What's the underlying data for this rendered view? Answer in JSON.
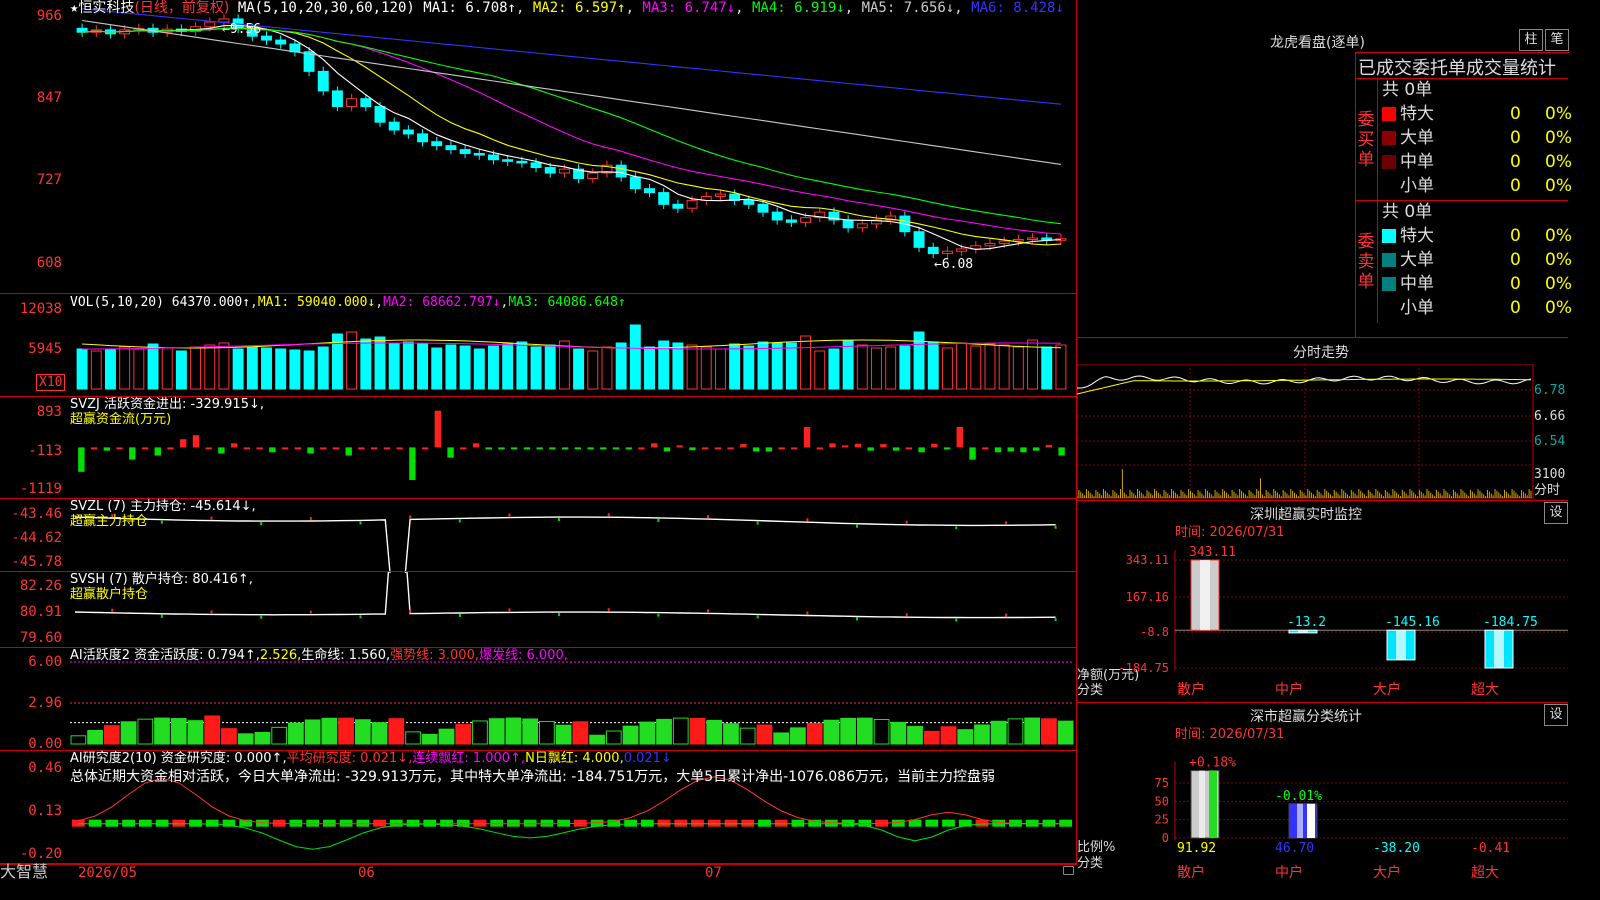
{
  "app": {
    "brand": "大智慧"
  },
  "kline": {
    "star": "★",
    "stock_name": "恒实科技",
    "period": "(日线，前复权)",
    "ma_params": "MA(5,10,20,30,60,120)",
    "ma1": "MA1: 6.708↑",
    "ma2": "MA2: 6.597↑",
    "ma3": "MA3: 6.747↓",
    "ma4": "MA4: 6.919↓",
    "ma5": "MA5: 7.656↓",
    "ma6": "MA6: 8.428↓",
    "axis": [
      "966",
      "847",
      "727",
      "608"
    ],
    "high_mark": "9.56",
    "low_mark": "6.08",
    "colors": {
      "up": "#ff3333",
      "down": "#00ffff",
      "ma1": "#ffffff",
      "ma2": "#ffff00",
      "ma3": "#ff00ff",
      "ma4": "#00ff00",
      "ma5": "#c8c8c8",
      "ma6": "#3333ff"
    }
  },
  "vol": {
    "title": "VOL(5,10,20)",
    "value": "64370.000↑",
    "ma1": "MA1: 59040.000↓",
    "ma2": "MA2: 68662.797↓",
    "ma3": "MA3: 64086.648↑",
    "axis": [
      "12038",
      "5945"
    ],
    "unit": "X10"
  },
  "svzj": {
    "title": "SVZJ  活跃资金进出: -329.915↓,",
    "sub": "超赢资金流(万元)",
    "axis": [
      "893",
      "-113",
      "-1119"
    ]
  },
  "svzl": {
    "title": "SVZL (7) 主力持仓: -45.614↓,",
    "sub": "超赢主力持仓",
    "axis": [
      "-43.46",
      "-44.62",
      "-45.78"
    ]
  },
  "svsh": {
    "title": "SVSH (7) 散户持仓: 80.416↑,",
    "sub": "超赢散户持仓",
    "axis": [
      "82.26",
      "80.91",
      "79.60"
    ]
  },
  "ai_active": {
    "p1": "AI活跃度2",
    "p2": " 资金活跃度: 0.794↑,",
    "p3": "2.526,",
    "p4": "生命线: 1.560,",
    "p5": "强势线: 3.000,",
    "p6": "爆发线: 6.000,",
    "axis": [
      "6.00",
      "2.96",
      "0.00"
    ]
  },
  "ai_research": {
    "p1": "AI研究度2(10)",
    "p2": " 资金研究度: 0.000↑,",
    "p3": "平均研究度: 0.021↓,",
    "p4": "连续飘红: 1.000↑,",
    "p5": "N日飘红: 4.000,",
    "p6": "0.021↓",
    "summary": "总体近期大资金相对活跃，今日大单净流出: -329.913万元，其中特大单净流出: -184.751万元，大单5日累计净出-1076.086万元，当前主力控盘弱",
    "axis": [
      "0.46",
      "0.13",
      "-0.20"
    ]
  },
  "xaxis": {
    "dates": [
      "2026/05",
      "06",
      "07"
    ]
  },
  "dragon": {
    "title": "龙虎看盘(逐单)",
    "btn1": "柱",
    "btn2": "笔",
    "stats_title": "已成交委托单成交量统计",
    "buy_label": "委买单",
    "sell_label": "委卖单",
    "buy_total": "共 0单",
    "sell_total": "共 0单",
    "buy_rows": [
      {
        "name": "特大",
        "count": "0",
        "pct": "0%",
        "color": "#ff0000"
      },
      {
        "name": "大单",
        "count": "0",
        "pct": "0%",
        "color": "#8b0000"
      },
      {
        "name": "中单",
        "count": "0",
        "pct": "0%",
        "color": "#6b0000"
      },
      {
        "name": "小单",
        "count": "0",
        "pct": "0%",
        "color": ""
      }
    ],
    "sell_rows": [
      {
        "name": "特大",
        "count": "0",
        "pct": "0%",
        "color": "#00ffff"
      },
      {
        "name": "大单",
        "count": "0",
        "pct": "0%",
        "color": "#008080"
      },
      {
        "name": "中单",
        "count": "0",
        "pct": "0%",
        "color": "#008080"
      },
      {
        "name": "小单",
        "count": "0",
        "pct": "0%",
        "color": ""
      }
    ]
  },
  "intraday": {
    "title": "分时走势",
    "axis": [
      "6.78",
      "6.66",
      "6.54",
      "3100",
      "分时"
    ]
  },
  "monitor": {
    "title": "深圳超赢实时监控",
    "btn": "设",
    "time": "时间: 2026/07/31",
    "axis": [
      "343.11",
      "167.16",
      "-8.8",
      "-184.75"
    ],
    "unit1": "净额(万元)",
    "unit2": "分类",
    "bars": [
      {
        "cat": "散户",
        "value": 343.11,
        "label": "343.11"
      },
      {
        "cat": "中户",
        "value": -13.2,
        "label": "-13.2"
      },
      {
        "cat": "大户",
        "value": -145.16,
        "label": "-145.16"
      },
      {
        "cat": "超大",
        "value": -184.75,
        "label": "-184.75"
      }
    ]
  },
  "classify": {
    "title": "深市超赢分类统计",
    "btn": "设",
    "time": "时间: 2026/07/31",
    "axis": [
      "75",
      "50",
      "25",
      "0"
    ],
    "unit1": "比例%",
    "unit2": "分类",
    "top_labels": [
      "+0.18%",
      "-0.01%"
    ],
    "cats": [
      "散户",
      "中户",
      "大户",
      "超大"
    ],
    "values": [
      "91.92",
      "46.70",
      "-38.20",
      "-0.41"
    ]
  },
  "chart_data": [
    {
      "type": "candlestick",
      "title": "恒实科技 (日线，前复权)",
      "ylim": [
        6.08,
        9.66
      ],
      "high": 9.56,
      "low": 6.08,
      "close_series": [
        9.35,
        9.38,
        9.33,
        9.38,
        9.4,
        9.35,
        9.39,
        9.36,
        9.42,
        9.48,
        9.52,
        9.4,
        9.3,
        9.25,
        9.2,
        9.1,
        8.85,
        8.6,
        8.4,
        8.5,
        8.4,
        8.2,
        8.1,
        8.05,
        7.95,
        7.9,
        7.85,
        7.8,
        7.78,
        7.72,
        7.7,
        7.68,
        7.62,
        7.55,
        7.6,
        7.48,
        7.55,
        7.65,
        7.5,
        7.35,
        7.3,
        7.15,
        7.1,
        7.2,
        7.25,
        7.28,
        7.2,
        7.15,
        7.05,
        6.95,
        6.92,
        6.98,
        7.05,
        6.95,
        6.85,
        6.9,
        6.95,
        7.0,
        6.8,
        6.6,
        6.52,
        6.55,
        6.58,
        6.62,
        6.65,
        6.68,
        6.7,
        6.72,
        6.69,
        6.71
      ]
    },
    {
      "type": "bar",
      "title": "VOL(5,10,20)",
      "unit": "X10",
      "ylim": [
        0,
        12038
      ]
    },
    {
      "type": "bar",
      "title": "超赢资金流(万元)",
      "ylim": [
        -1119,
        893
      ],
      "values": [
        -600,
        0,
        -80,
        0,
        -300,
        0,
        -200,
        0,
        200,
        300,
        0,
        -150,
        100,
        0,
        0,
        -120,
        0,
        0,
        -150,
        0,
        0,
        -200,
        0,
        0,
        0,
        0,
        -800,
        0,
        900,
        -250,
        0,
        100,
        -30,
        -30,
        -30,
        -30,
        -30,
        -30,
        -30,
        -20,
        -30,
        -30,
        -30,
        -30,
        0,
        100,
        -100,
        50,
        -70,
        0,
        0,
        0,
        80,
        -100,
        -100,
        0,
        0,
        500,
        0,
        100,
        50,
        90,
        -80,
        80,
        -80,
        0,
        -120,
        90,
        -40,
        500,
        -300,
        0,
        -120,
        -100,
        -120,
        -80,
        60,
        -200
      ]
    },
    {
      "type": "line",
      "title": "超赢主力持仓",
      "ylim": [
        -45.78,
        -43.46
      ]
    },
    {
      "type": "line",
      "title": "超赢散户持仓",
      "ylim": [
        79.6,
        82.26
      ]
    },
    {
      "type": "bar",
      "title": "AI活跃度2",
      "ylim": [
        0,
        6
      ],
      "lines": {
        "强势线": 3.0,
        "爆发线": 6.0,
        "生命线": 1.56
      }
    },
    {
      "type": "bar",
      "title": "深圳超赢实时监控",
      "categories": [
        "散户",
        "中户",
        "大户",
        "超大"
      ],
      "values": [
        343.11,
        -13.2,
        -145.16,
        -184.75
      ],
      "ylabel": "净额(万元)",
      "ylim": [
        -184.75,
        343.11
      ]
    },
    {
      "type": "bar",
      "title": "深市超赢分类统计",
      "categories": [
        "散户",
        "中户",
        "大户",
        "超大"
      ],
      "values": [
        91.92,
        46.7,
        -38.2,
        -0.41
      ],
      "ylabel": "比例%"
    }
  ]
}
